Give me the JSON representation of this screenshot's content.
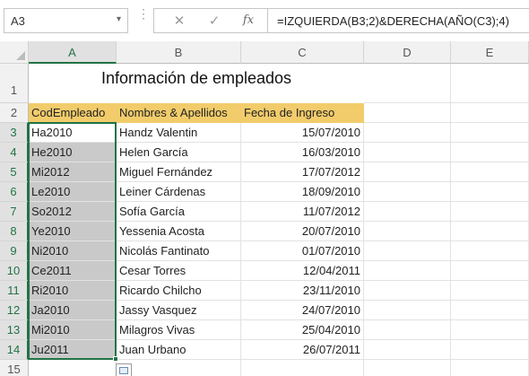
{
  "formula_bar": {
    "name_box": "A3",
    "name_box_arrow": "▾",
    "grip": "⋮",
    "cancel_glyph": "✕",
    "enter_glyph": "✓",
    "fx_glyph": "fx",
    "formula": "=IZQUIERDA(B3;2)&DERECHA(AÑO(C3);4)"
  },
  "columns": [
    "A",
    "B",
    "C",
    "D",
    "E"
  ],
  "rows": [
    "1",
    "2",
    "3",
    "4",
    "5",
    "6",
    "7",
    "8",
    "9",
    "10",
    "11",
    "12",
    "13",
    "14",
    "15"
  ],
  "sheet": {
    "title": "Información de empleados",
    "headers": [
      "CodEmpleado",
      "Nombres & Apellidos",
      "Fecha de Ingreso"
    ],
    "records": [
      [
        "Ha2010",
        "Handz Valentin",
        "15/07/2010"
      ],
      [
        "He2010",
        "Helen García",
        "16/03/2010"
      ],
      [
        "Mi2012",
        "Miguel Fernández",
        "17/07/2012"
      ],
      [
        "Le2010",
        "Leiner Cárdenas",
        "18/09/2010"
      ],
      [
        "So2012",
        "Sofía García",
        "11/07/2012"
      ],
      [
        "Ye2010",
        "Yessenia Acosta",
        "20/07/2010"
      ],
      [
        "Ni2010",
        "Nicolás Fantinato",
        "01/07/2010"
      ],
      [
        "Ce2011",
        "Cesar Torres",
        "12/04/2011"
      ],
      [
        "Ri2010",
        "Ricardo Chilcho",
        "23/11/2010"
      ],
      [
        "Ja2010",
        "Jassy Vasquez",
        "24/07/2010"
      ],
      [
        "Mi2010",
        "Milagros Vivas",
        "25/04/2010"
      ],
      [
        "Ju2011",
        "Juan Urbano",
        "26/07/2011"
      ]
    ]
  },
  "colors": {
    "header_fill": "#f2cc6b",
    "selection_fill": "#c9c9c9",
    "selection_border": "#217346"
  },
  "icons": {
    "quick_analysis": "quick-analysis-icon"
  }
}
